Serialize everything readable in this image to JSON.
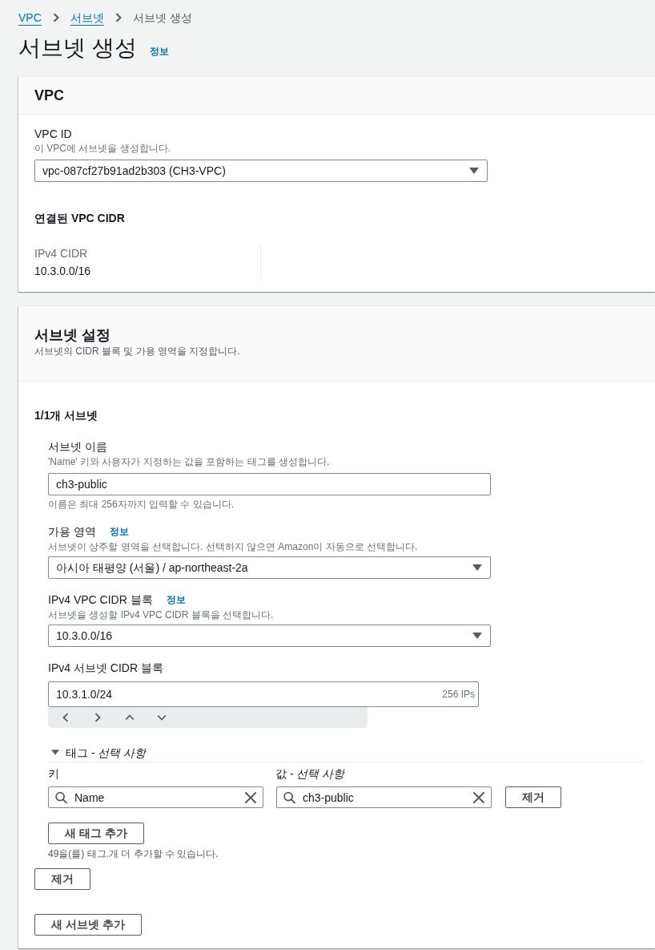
{
  "breadcrumb": [
    {
      "label": "VPC",
      "kind": "link"
    },
    {
      "label": "서브넷",
      "kind": "link"
    },
    {
      "label": "서브넷 생성",
      "kind": "current"
    }
  ],
  "page_title": "서브넷 생성",
  "page_info": "정보",
  "vpc_panel": {
    "title": "VPC",
    "vpc_id": {
      "label": "VPC ID",
      "description": "이 VPC에 서브넷을 생성합니다.",
      "value": "vpc-087cf27b91ad2b303 (CH3-VPC)"
    },
    "cidr_heading": "연결된 VPC CIDR",
    "cidrs": [
      {
        "label": "IPv4 CIDR",
        "value": "10.3.0.0/16"
      }
    ]
  },
  "subnet_panel": {
    "title": "서브넷 설정",
    "description": "서브넷의 CIDR 블록 및 가용 영역을 지정합니다.",
    "subnets": [
      {
        "heading": "1/1개 서브넷",
        "fields": [
          {
            "kind": "text",
            "label": "서브넷 이름",
            "description": "'Name' 키와 사용자가 지정하는 값을 포함하는 태그를 생성합니다.",
            "value": "ch3-public",
            "constraint": "이름은 최대 256자까지 입력할 수 있습니다."
          },
          {
            "kind": "select",
            "label": "가용 영역",
            "info": "정보",
            "description": "서브넷이 상주할 영역을 선택합니다. 선택하지 않으면 Amazon이 자동으로 선택합니다.",
            "value": "아시아 태평양 (서울) / ap-northeast-2a"
          },
          {
            "kind": "select",
            "label": "IPv4 VPC CIDR 블록",
            "info": "정보",
            "description": "서브넷을 생성할 IPv4 VPC CIDR 블록을 선택합니다.",
            "value": "10.3.0.0/16"
          },
          {
            "kind": "cidr",
            "label": "IPv4 서브넷 CIDR 블록",
            "value": "10.3.1.0/24",
            "ip_count": "256 IPs"
          }
        ],
        "tags": {
          "title": "태그 - *선택 사항*",
          "expanded": true,
          "key_label": "키",
          "value_label": "값 - *선택 사항*",
          "items": [
            {
              "key": "Name",
              "value": "ch3-public",
              "remove_button": "제거"
            }
          ],
          "add_button": "새 태그 추가",
          "note": "49을(를) 태그.개 더 추가할 수 있습니다."
        },
        "remove_button": "제거"
      }
    ],
    "add_button": "새 서브넷 추가"
  }
}
